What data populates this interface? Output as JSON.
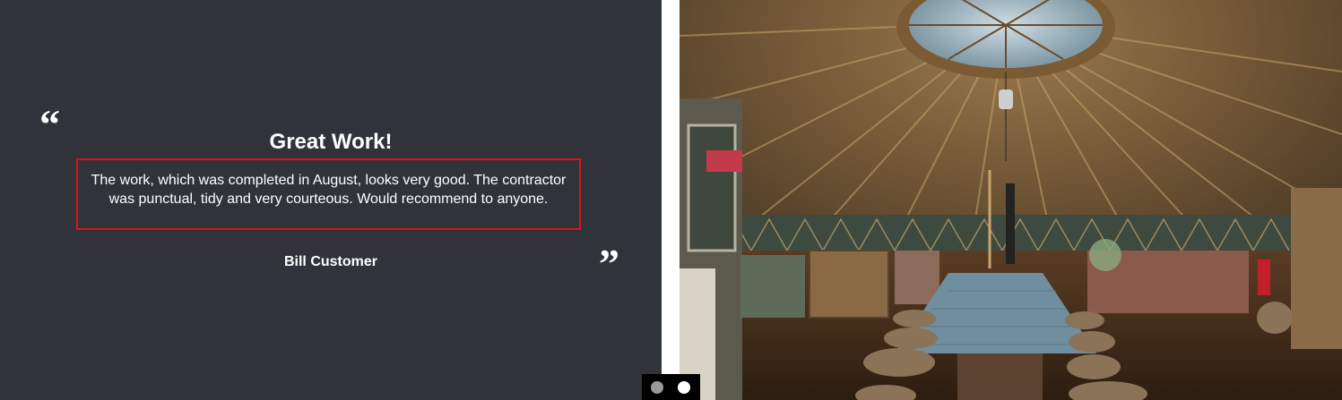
{
  "testimonial": {
    "open_quote": "“",
    "close_quote": "”",
    "title": "Great Work!",
    "body": "The work, which was completed in August, looks very good. The contractor was punctual, tidy and very courteous. Would recommend to anyone.",
    "author": "Bill Customer",
    "background_color": "#30333a",
    "highlight_border_color": "#e0101a"
  },
  "photo": {
    "subject": "yurt-interior-image"
  },
  "slider": {
    "slide_count": 2,
    "active_slide": 2
  }
}
